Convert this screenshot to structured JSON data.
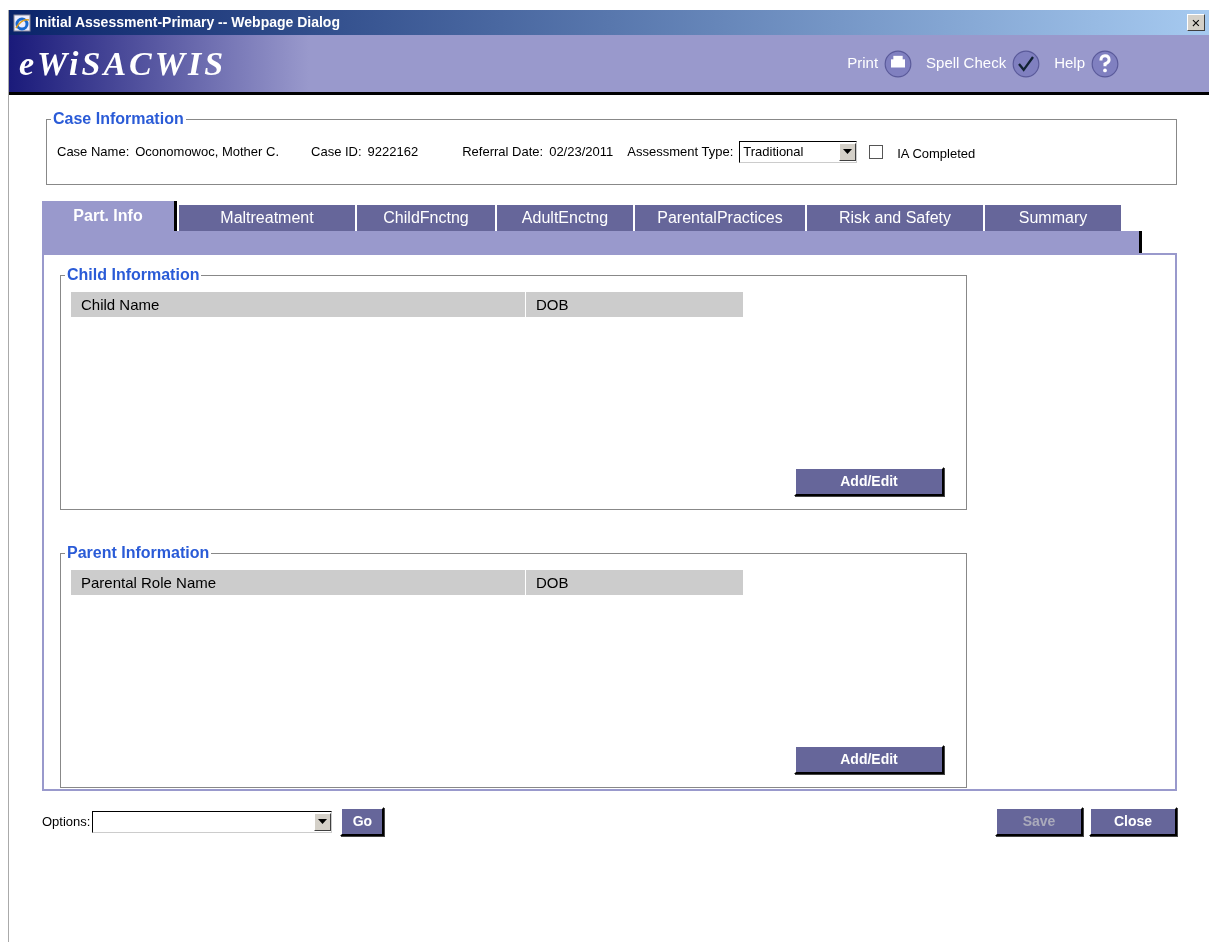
{
  "window": {
    "title": "Initial Assessment-Primary -- Webpage Dialog",
    "close": "×"
  },
  "banner": {
    "logo": "eWiSACWIS",
    "tools": [
      {
        "label": "Print",
        "kind": "print"
      },
      {
        "label": "Spell Check",
        "kind": "spell"
      },
      {
        "label": "Help",
        "kind": "help"
      }
    ]
  },
  "case_information": {
    "legend": "Case Information",
    "fields": [
      {
        "label": "Case Name:",
        "value": "Oconomowoc, Mother C."
      },
      {
        "label": "Case ID:",
        "value": "9222162"
      },
      {
        "label": "Referral Date:",
        "value": "02/23/2011"
      }
    ],
    "assessment_type": {
      "label": "Assessment Type:",
      "value": "Traditional"
    },
    "ia_completed": {
      "label": "IA Completed",
      "checked": false
    }
  },
  "tabs": [
    {
      "label": "Part. Info",
      "selected": true
    },
    {
      "label": "Maltreatment",
      "selected": false
    },
    {
      "label": "ChildFnctng",
      "selected": false
    },
    {
      "label": "AdultEnctng",
      "selected": false
    },
    {
      "label": "ParentalPractices",
      "selected": false
    },
    {
      "label": "Risk and Safety",
      "selected": false
    },
    {
      "label": "Summary",
      "selected": false
    }
  ],
  "sections": [
    {
      "legend": "Child Information",
      "columns": [
        "Child Name",
        "DOB"
      ],
      "button": "Add/Edit"
    },
    {
      "legend": "Parent Information",
      "columns": [
        "Parental Role Name",
        "DOB"
      ],
      "button": "Add/Edit"
    }
  ],
  "footer": {
    "options": {
      "label": "Options:"
    },
    "go": "Go",
    "buttons": [
      {
        "label": "Save",
        "disabled": true
      },
      {
        "label": "Close",
        "disabled": false
      }
    ]
  }
}
